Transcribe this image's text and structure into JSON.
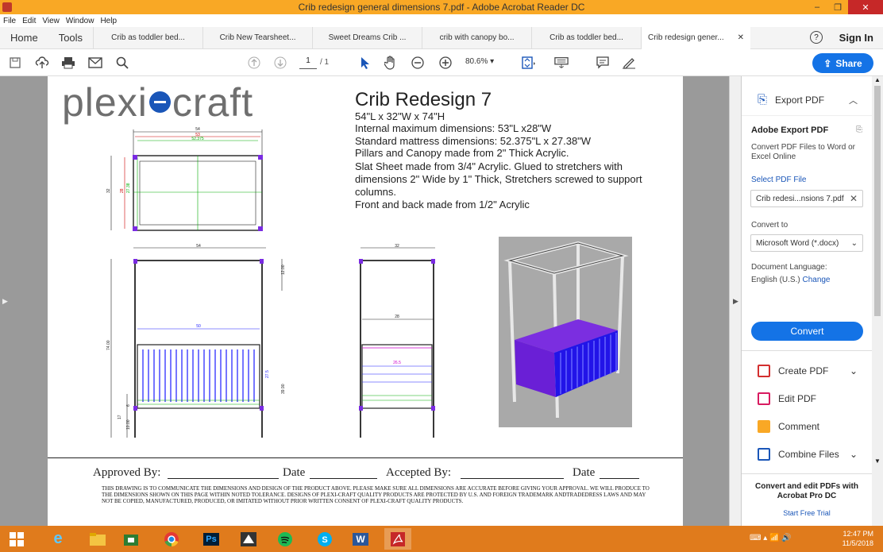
{
  "window": {
    "title": "Crib redesign general dimensions 7.pdf - Adobe Acrobat Reader DC",
    "controls": {
      "minimize": "–",
      "restore": "❐",
      "close": "✕"
    }
  },
  "menu": [
    "File",
    "Edit",
    "View",
    "Window",
    "Help"
  ],
  "tabs": {
    "home": "Home",
    "tools": "Tools",
    "documents": [
      "Crib as toddler bed...",
      "Crib New Tearsheet...",
      "Sweet Dreams Crib ...",
      "crib with canopy bo...",
      "Crib as toddler bed...",
      "Crib redesign gener..."
    ],
    "close": "✕",
    "help": "?",
    "sign_in": "Sign In"
  },
  "toolbar": {
    "page_current": "1",
    "page_total": "/ 1",
    "zoom": "80.6%",
    "share": "Share"
  },
  "document": {
    "logo_left": "plexi",
    "logo_right": "craft",
    "title": "Crib Redesign 7",
    "lines": [
      "54\"L x 32\"W x 74\"H",
      "Internal maximum dimensions: 53\"L x28\"W",
      "Standard mattress dimensions:   52.375\"L x 27.38\"W",
      "Pillars and Canopy made from 2\" Thick Acrylic.",
      "Slat Sheet made from 3/4\" Acrylic. Glued to stretchers  with",
      "dimensions 2\" Wide by 1\" Thick, Stretchers screwed to support",
      "columns.",
      "Front and back made from 1/2\" Acrylic"
    ],
    "dims": {
      "top_54": "54",
      "top_53": "53",
      "top_52375": "52.375",
      "top_32": "32",
      "top_28": "28",
      "top_2738": "27.38",
      "front_54": "54",
      "front_50": "50",
      "front_7400": "74.00",
      "front_1200": "12.00",
      "front_275": "27.5",
      "front_3990": "39.90",
      "front_17": "17",
      "front_6": "6",
      "front_1000": "10.00",
      "side_32": "32",
      "side_28": "28",
      "side_265": "26.5"
    },
    "approved": "Approved By:",
    "date": "Date",
    "accepted": "Accepted By:",
    "legal": "THIS DRAWING IS TO COMMUNICATE THE DIMENSIONS AND DESIGN OF THE PRODUCT ABOVE.  PLEASE MAKE SURE ALL DIMENSIONS ARE ACCURATE BEFORE GIVING YOUR APPROVAL.  WE WILL PRODUCE TO THE DIMENSIONS SHOWN ON THIS PAGE WITHIN NOTED TOLERANCE.  DESIGNS OF PLEXI-CRAFT QUALITY PRODUCTS ARE PROTECTED BY U.S. AND FOREIGN TRADEMARK ANDTRADEDRESS LAWS AND MAY NOT BE COPIED, MANUFACTURED, PRODUCED, OR  IMITATED WITHOUT PRIOR WRITTEN CONSENT OF PLEXI-CRAFT QUALITY PRODUCTS."
  },
  "pane": {
    "export_title": "Export PDF",
    "export_subtitle": "Adobe Export PDF",
    "export_desc": "Convert PDF Files to Word or Excel Online",
    "select_label": "Select PDF File",
    "file_name": "Crib redesi...nsions 7.pdf",
    "convert_to_label": "Convert to",
    "convert_to_value": "Microsoft Word (*.docx)",
    "language_label": "Document Language:",
    "language_value": "English (U.S.)",
    "language_change": "Change",
    "convert_button": "Convert",
    "tools": [
      "Create PDF",
      "Edit PDF",
      "Comment",
      "Combine Files"
    ],
    "promo_title": "Convert and edit PDFs with Acrobat Pro DC",
    "promo_link": "Start Free Trial"
  },
  "taskbar": {
    "time": "12:47 PM",
    "date": "11/5/2018",
    "ps_label": "Ps",
    "word_label": "W"
  },
  "colors": {
    "titlebar": "#f9a825",
    "accent_blue": "#1473e6",
    "taskbar": "#e07b1c",
    "drawing_blue": "#1a1aff",
    "drawing_purple": "#8b2be2"
  }
}
